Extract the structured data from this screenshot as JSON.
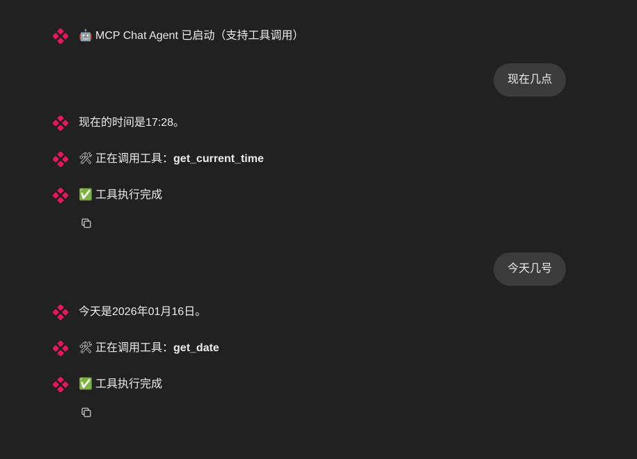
{
  "colors": {
    "background": "#212121",
    "user_bubble": "#3b3b3b",
    "text": "#ececec",
    "avatar_accent": "#e8175d"
  },
  "icons": {
    "avatar": "clover-logo-icon",
    "copy": "copy-icon",
    "robot": "robot-emoji",
    "tools": "hammer-wrench-emoji",
    "check": "check-mark-emoji"
  },
  "messages": [
    {
      "role": "assistant",
      "emoji": "🤖",
      "text": "MCP Chat Agent 已启动（支持工具调用）"
    },
    {
      "role": "user",
      "text": "现在几点"
    },
    {
      "role": "assistant",
      "text": "现在的时间是17:28。"
    },
    {
      "role": "assistant",
      "emoji": "🛠",
      "prefix": "正在调用工具：",
      "bold": "get_current_time"
    },
    {
      "role": "assistant",
      "emoji": "✅",
      "text": "工具执行完成"
    },
    {
      "role": "user",
      "text": "今天几号"
    },
    {
      "role": "assistant",
      "text": "今天是2026年01月16日。"
    },
    {
      "role": "assistant",
      "emoji": "🛠",
      "prefix": "正在调用工具：",
      "bold": "get_date"
    },
    {
      "role": "assistant",
      "emoji": "✅",
      "text": "工具执行完成"
    }
  ]
}
